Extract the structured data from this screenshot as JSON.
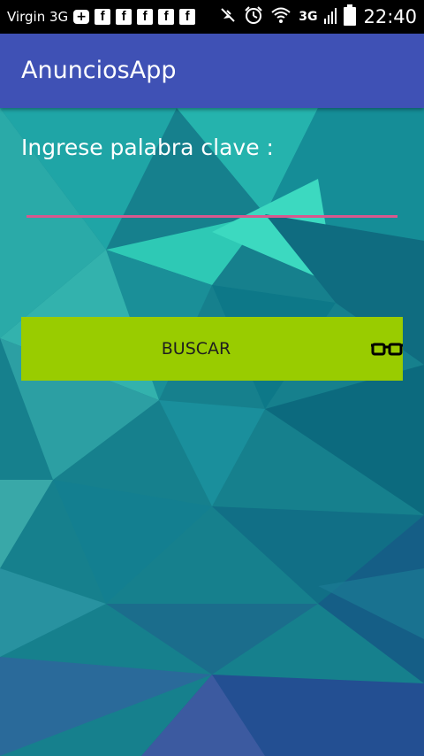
{
  "status_bar": {
    "carrier": "Virgin 3G",
    "network": "3G",
    "time": "22:40",
    "notification_icons": [
      "plus-icon",
      "facebook-icon",
      "facebook-icon",
      "facebook-icon",
      "facebook-icon",
      "facebook-icon"
    ],
    "status_icons": [
      "mute-icon",
      "alarm-icon",
      "wifi-icon",
      "signal-icon",
      "battery-icon"
    ]
  },
  "app_bar": {
    "title": "AnunciosApp",
    "color": "#3f51b5"
  },
  "form": {
    "label": "Ingrese palabra clave :",
    "input_value": "",
    "underline_color": "#d8588e"
  },
  "search_button": {
    "label": "BUSCAR",
    "icon": "glasses-icon",
    "color": "#99cc00"
  }
}
